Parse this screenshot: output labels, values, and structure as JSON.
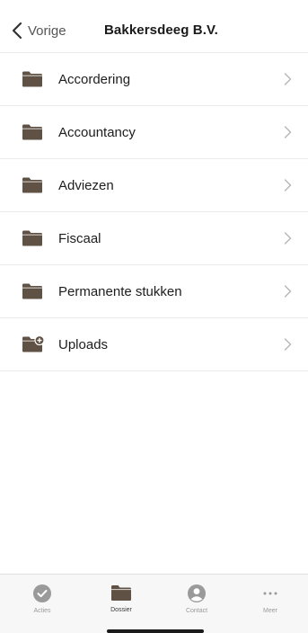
{
  "header": {
    "back_label": "Vorige",
    "title": "Bakkersdeeg B.V."
  },
  "folders": [
    {
      "label": "Accordering",
      "icon": "folder-icon"
    },
    {
      "label": "Accountancy",
      "icon": "folder-icon"
    },
    {
      "label": "Adviezen",
      "icon": "folder-icon"
    },
    {
      "label": "Fiscaal",
      "icon": "folder-icon"
    },
    {
      "label": "Permanente stukken",
      "icon": "folder-icon"
    },
    {
      "label": "Uploads",
      "icon": "folder-plus-icon"
    }
  ],
  "tabbar": {
    "tabs": [
      {
        "label": "Acties",
        "icon": "check-circle-icon",
        "active": false
      },
      {
        "label": "Dossier",
        "icon": "folder-icon",
        "active": true
      },
      {
        "label": "Contact",
        "icon": "person-circle-icon",
        "active": false
      },
      {
        "label": "Meer",
        "icon": "ellipsis-icon",
        "active": false
      }
    ]
  },
  "colors": {
    "folder": "#5f5144",
    "chevron": "#b5b5b5",
    "tab_inactive": "#9a9a9a",
    "tab_active": "#5f5144"
  }
}
